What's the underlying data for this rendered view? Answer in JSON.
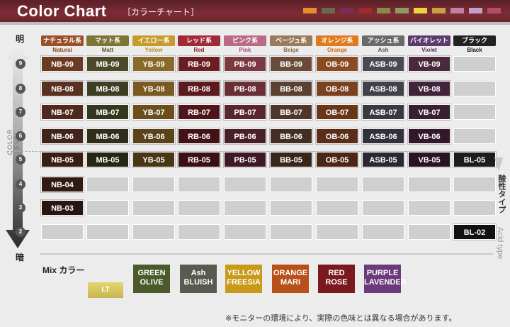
{
  "header": {
    "title": "Color Chart",
    "subtitle": "［カラーチャート］",
    "color_strip": [
      "#e88b2a",
      "#676a52",
      "#7a2d5c",
      "#9c2d2a",
      "#878a4a",
      "#8e9a66",
      "#e8d53a",
      "#c6a340",
      "#c080a0",
      "#c4a0c8",
      "#b84a6a"
    ]
  },
  "axis": {
    "top": "明",
    "bottom": "暗",
    "label": "COLOR LEVEL",
    "levels": [
      "9",
      "8",
      "7",
      "6",
      "5",
      "4",
      "3",
      "2"
    ]
  },
  "categories": [
    {
      "ja": "ナチュラル系",
      "en": "Natural",
      "color": "#9a4f2a",
      "text_color": "#8a4520"
    },
    {
      "ja": "マット系",
      "en": "Matt",
      "color": "#7c7635",
      "text_color": "#5a5a25"
    },
    {
      "ja": "イエロー系",
      "en": "Yellow",
      "color": "#c59c2c",
      "text_color": "#b8901f"
    },
    {
      "ja": "レッド系",
      "en": "Red",
      "color": "#a02a35",
      "text_color": "#8a2030"
    },
    {
      "ja": "ピンク系",
      "en": "Pink",
      "color": "#b96a86",
      "text_color": "#a05070"
    },
    {
      "ja": "ベージュ系",
      "en": "Beige",
      "color": "#9a7a5c",
      "text_color": "#8a6a4a"
    },
    {
      "ja": "オレンジ系",
      "en": "Orange",
      "color": "#e07a1a",
      "text_color": "#d06a10"
    },
    {
      "ja": "アッシュ系",
      "en": "Ash",
      "color": "#6a6a6a",
      "text_color": "#555555"
    },
    {
      "ja": "バイオレット系",
      "en": "Violet",
      "color": "#5c3a6e",
      "text_color": "#4a2a5a"
    },
    {
      "ja": "ブラック",
      "en": "Black",
      "color": "#222222",
      "text_color": "#111111"
    }
  ],
  "grid": [
    [
      "NB-09",
      "MB-09",
      "YB-09",
      "RB-09",
      "PB-09",
      "BB-09",
      "OB-09",
      "ASB-09",
      "VB-09",
      ""
    ],
    [
      "NB-08",
      "MB-08",
      "YB-08",
      "RB-08",
      "PB-08",
      "BB-08",
      "OB-08",
      "ASB-08",
      "VB-08",
      ""
    ],
    [
      "NB-07",
      "MB-07",
      "YB-07",
      "RB-07",
      "PB-07",
      "BB-07",
      "OB-07",
      "ASB-07",
      "VB-07",
      ""
    ],
    [
      "NB-06",
      "MB-06",
      "YB-06",
      "RB-06",
      "PB-06",
      "BB-06",
      "OB-06",
      "ASB-06",
      "VB-06",
      ""
    ],
    [
      "NB-05",
      "MB-05",
      "YB-05",
      "RB-05",
      "PB-05",
      "BB-05",
      "OB-05",
      "ASB-05",
      "VB-05",
      "BL-05"
    ],
    [
      "NB-04",
      "",
      "",
      "",
      "",
      "",
      "",
      "",
      "",
      ""
    ],
    [
      "NB-03",
      "",
      "",
      "",
      "",
      "",
      "",
      "",
      "",
      ""
    ],
    [
      "",
      "",
      "",
      "",
      "",
      "",
      "",
      "",
      "",
      "BL-02"
    ]
  ],
  "swatch_colors": [
    [
      "#6a3a22",
      "#4a4a28",
      "#8a6a2a",
      "#6a1e22",
      "#7a3a40",
      "#6a4a38",
      "#8a4a22",
      "#4a4850",
      "#4a2a3a",
      ""
    ],
    [
      "#5a3020",
      "#3e3e22",
      "#7a5a22",
      "#5a1a1e",
      "#6a2e36",
      "#5a4030",
      "#7a4020",
      "#424048",
      "#42243a",
      ""
    ],
    [
      "#4e2a1c",
      "#36361e",
      "#6a4e1e",
      "#4e1618",
      "#5a262e",
      "#4e3628",
      "#6a361a",
      "#3a3840",
      "#3a1e32",
      ""
    ],
    [
      "#42241a",
      "#2e2e1a",
      "#5a421a",
      "#421216",
      "#4a2028",
      "#422e22",
      "#5a2e18",
      "#323038",
      "#32182a",
      ""
    ],
    [
      "#3a1e14",
      "#262614",
      "#4a3616",
      "#3a1012",
      "#3e1a22",
      "#38261c",
      "#4a2614",
      "#2a2830",
      "#2a1424",
      "#1c1c1c"
    ],
    [
      "#321a12",
      "",
      "",
      "",
      "",
      "",
      "",
      "",
      "",
      ""
    ],
    [
      "#2a1610",
      "",
      "",
      "",
      "",
      "",
      "",
      "",
      "",
      ""
    ],
    [
      "",
      "",
      "",
      "",
      "",
      "",
      "",
      "",
      "",
      "#111111"
    ]
  ],
  "acid_label": "酸性タイプ",
  "acid_type": "Acid type",
  "mix": {
    "label": "Mix カラー",
    "lt": "LT",
    "items": [
      {
        "line1": "GREEN",
        "line2": "OLIVE",
        "color": "#4a5a2a"
      },
      {
        "line1": "Ash",
        "line2": "BLUISH",
        "color": "#5a5a50"
      },
      {
        "line1": "YELLOW",
        "line2": "FREESIA",
        "color": "#c89a18"
      },
      {
        "line1": "ORANGE",
        "line2": "MARI",
        "color": "#b8501a"
      },
      {
        "line1": "RED",
        "line2": "ROSE",
        "color": "#7a1a20"
      },
      {
        "line1": "PURPLE",
        "line2": "LAVENDER",
        "color": "#6a3a7a"
      }
    ]
  },
  "note": "※モニターの環境により、実際の色味とは異なる場合があります。"
}
